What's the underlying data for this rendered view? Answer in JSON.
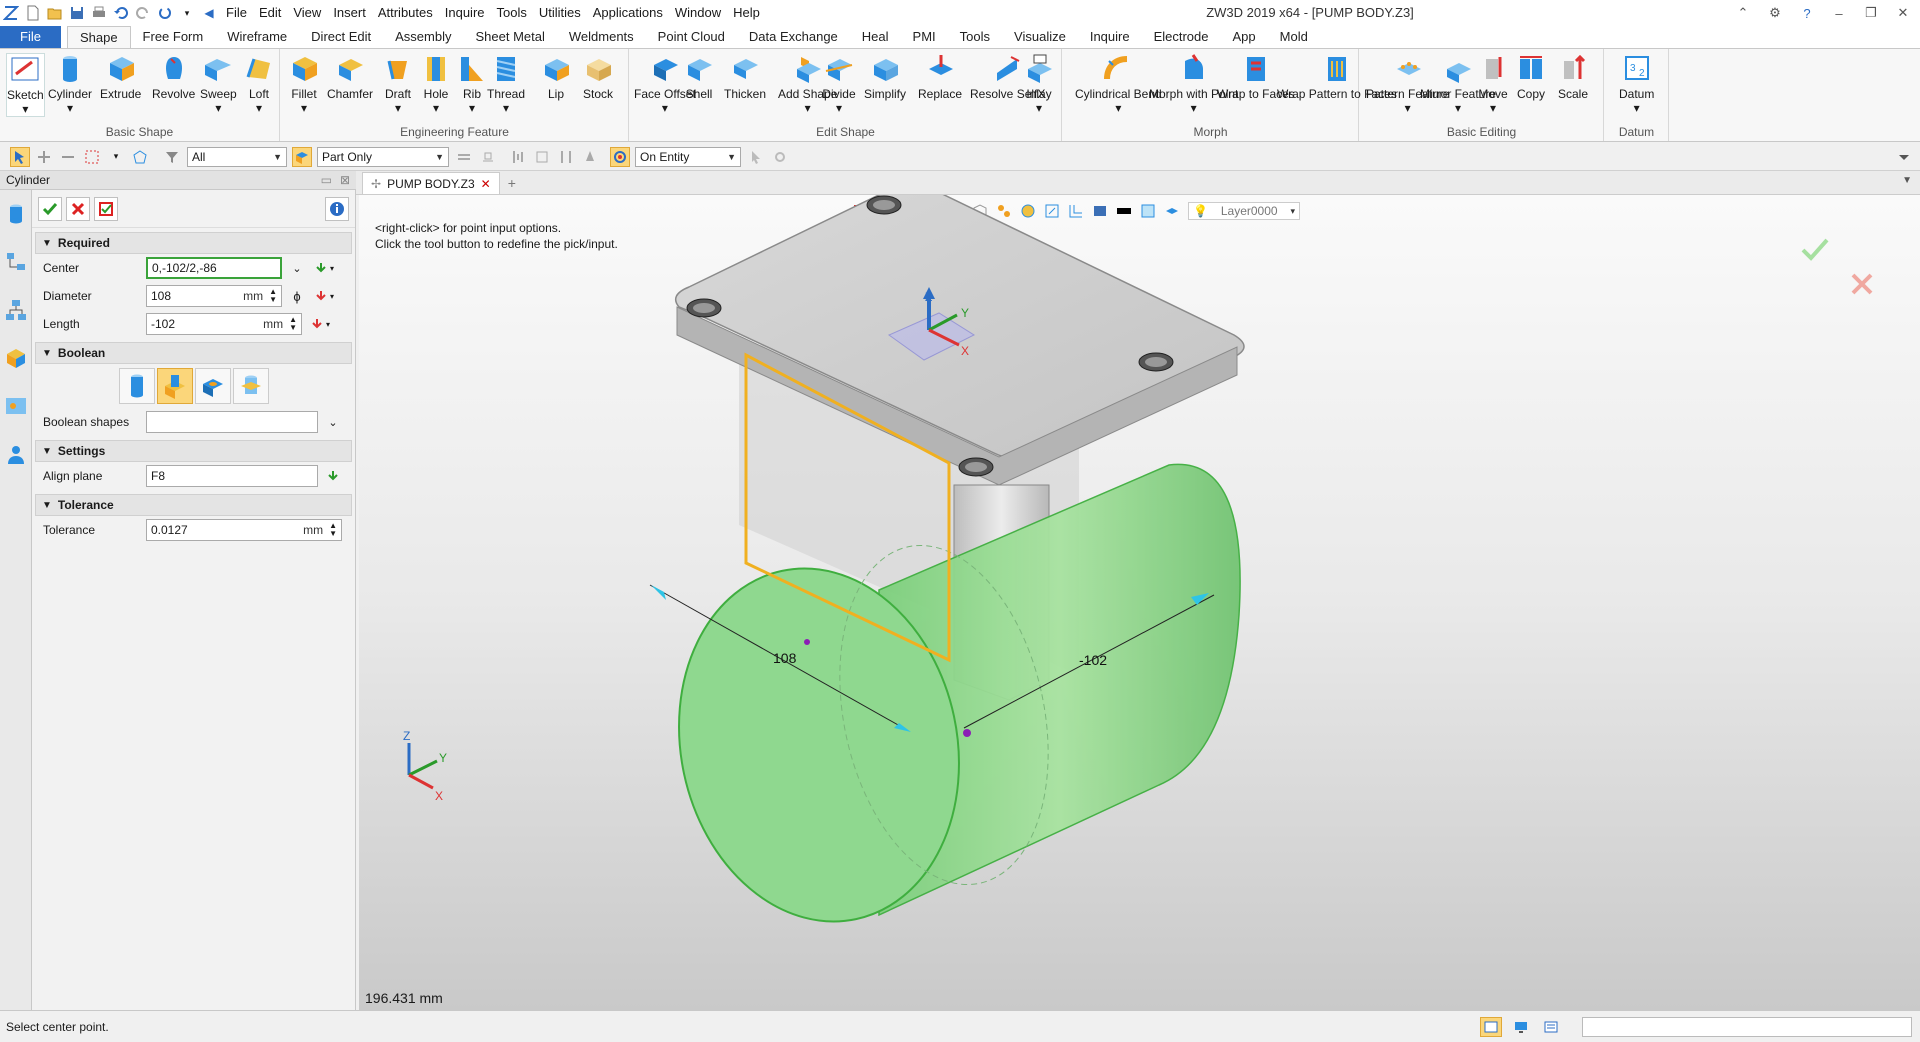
{
  "app": {
    "window_title": "ZW3D 2019  x64 - [PUMP BODY.Z3]",
    "menu": [
      "File",
      "Edit",
      "View",
      "Insert",
      "Attributes",
      "Inquire",
      "Tools",
      "Utilities",
      "Applications",
      "Window",
      "Help"
    ]
  },
  "ribbon": {
    "file_tab": "File",
    "tabs": [
      "Shape",
      "Free Form",
      "Wireframe",
      "Direct Edit",
      "Assembly",
      "Sheet Metal",
      "Weldments",
      "Point Cloud",
      "Data Exchange",
      "Heal",
      "PMI",
      "Tools",
      "Visualize",
      "Inquire",
      "Electrode",
      "App",
      "Mold"
    ],
    "active_tab": "Shape",
    "groups": [
      {
        "title": "Basic Shape",
        "tools": [
          "Sketch",
          "Cylinder",
          "Extrude",
          "Revolve",
          "Sweep",
          "Loft"
        ]
      },
      {
        "title": "Engineering Feature",
        "tools": [
          "Fillet",
          "Chamfer",
          "Draft",
          "Hole",
          "Rib",
          "Thread",
          "Lip",
          "Stock"
        ]
      },
      {
        "title": "Edit Shape",
        "tools": [
          "Face Offset",
          "Shell",
          "Thicken",
          "Add Shape",
          "Divide",
          "Simplify",
          "Replace",
          "Resolve SelfX",
          "Inlay"
        ]
      },
      {
        "title": "Morph",
        "tools": [
          "Cylindrical Bend",
          "Morph with Point",
          "Wrap to Faces",
          "Wrap Pattern to Faces"
        ]
      },
      {
        "title": "Basic Editing",
        "tools": [
          "Pattern Feature",
          "Mirror Feature",
          "Move",
          "Copy",
          "Scale"
        ]
      },
      {
        "title": "Datum",
        "tools": [
          "Datum"
        ]
      }
    ]
  },
  "filterbar": {
    "filter": "All",
    "scope": "Part Only",
    "pick": "On Entity"
  },
  "panel": {
    "title": "Cylinder",
    "sections": {
      "required": "Required",
      "boolean": "Boolean",
      "settings": "Settings",
      "tolerance": "Tolerance"
    },
    "center_label": "Center",
    "center_value": "0,-102/2,-86",
    "diameter_label": "Diameter",
    "diameter_value": "108",
    "diameter_unit": "mm",
    "length_label": "Length",
    "length_value": "-102",
    "length_unit": "mm",
    "boolean_shapes_label": "Boolean shapes",
    "boolean_shapes_value": "",
    "align_plane_label": "Align plane",
    "align_plane_value": "F8",
    "tolerance_label": "Tolerance",
    "tolerance_value": "0.0127",
    "tolerance_unit": "mm"
  },
  "document": {
    "tab_label": "PUMP BODY.Z3",
    "layer": "Layer0000"
  },
  "viewport": {
    "hint_line1": "<right-click> for point input options.",
    "hint_line2": "Click the tool button to redefine the pick/input.",
    "dim_diameter": "108",
    "dim_length": "-102",
    "distance_readout": "196.431 mm",
    "triad_labels": {
      "z": "Z",
      "y": "Y",
      "x": "X"
    }
  },
  "status": {
    "prompt": "Select center point."
  },
  "colors": {
    "file_tab": "#2b6cc4",
    "preview_green": "#8fd88f",
    "highlight_orange": "#f0b020",
    "focus_green": "#3aa33a"
  }
}
